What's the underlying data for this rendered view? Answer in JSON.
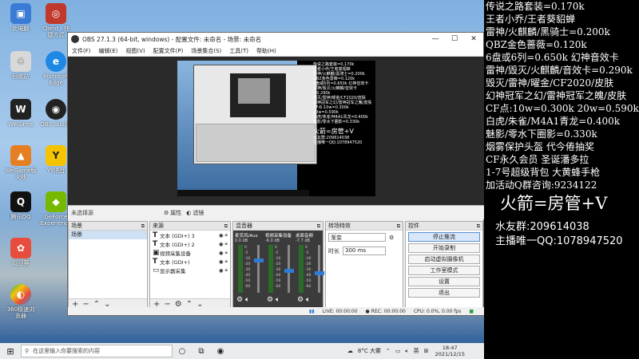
{
  "desktop_icons": [
    {
      "label": "此电脑",
      "color": "#3a7bd5",
      "glyph": "▣"
    },
    {
      "label": "Client - 快\n捷方式",
      "color": "#c0392b",
      "glyph": "◎"
    },
    {
      "label": "回收站",
      "color": "#e6e6e6",
      "glyph": "♲"
    },
    {
      "label": "Microsoft\nEdge",
      "color": "#1e88e5",
      "glyph": "e"
    },
    {
      "label": "WeGame",
      "color": "#222222",
      "glyph": "W"
    },
    {
      "label": "OBS Studio",
      "color": "#222222",
      "glyph": "◉"
    },
    {
      "label": "WeGame版\n火线",
      "color": "#e67e22",
      "glyph": "▲"
    },
    {
      "label": "YY语音",
      "color": "#f5c400",
      "glyph": "Y"
    },
    {
      "label": "腾讯QQ",
      "color": "#111111",
      "glyph": "Q"
    },
    {
      "label": "GeForce\nExperience",
      "color": "#76b900",
      "glyph": "◆"
    },
    {
      "label": "向日葵",
      "color": "#e74c3c",
      "glyph": "✿"
    },
    {
      "label": "360极速浏\n览器",
      "color": "#27ae60",
      "glyph": "◐"
    }
  ],
  "obs": {
    "title": "OBS 27.1.3 (64-bit, windows) - 配置文件: 未命名 - 场景: 未命名",
    "menu": [
      "文件(F)",
      "编辑(E)",
      "视图(V)",
      "配置文件(P)",
      "场景集合(S)",
      "工具(T)",
      "帮助(H)"
    ],
    "current_source": "未选择源",
    "properties_label": "属性",
    "filters_label": "滤镜",
    "scenes": {
      "title": "场景",
      "items": [
        "场景"
      ]
    },
    "sources": {
      "title": "来源",
      "items": [
        {
          "type": "text",
          "label": "文本 (GDI+) 3"
        },
        {
          "type": "text",
          "label": "文本 (GDI+) 2"
        },
        {
          "type": "video",
          "label": "视频采集设备"
        },
        {
          "type": "text",
          "label": "文本 (GDI+)"
        },
        {
          "type": "display",
          "label": "显示器采集"
        }
      ]
    },
    "mixer": {
      "title": "混音器",
      "channels": [
        {
          "name": "麦克风/Aux",
          "db": "0.0 dB",
          "level": 0.72
        },
        {
          "name": "视频采集设备",
          "db": "-6.0 dB",
          "level": 0.5
        },
        {
          "name": "桌面音频",
          "db": "-7.7 dB",
          "level": 0.45
        }
      ],
      "scale": [
        "0",
        "-5",
        "-10",
        "-15",
        "-20",
        "-25",
        "-30",
        "-35",
        "-40",
        "-45",
        "-50",
        "-55",
        "-60"
      ]
    },
    "transitions": {
      "title": "转场特效",
      "type": "渐变",
      "duration_label": "时长",
      "duration": "300 ms"
    },
    "controls": {
      "title": "控件",
      "buttons": [
        "停止推流",
        "开始录制",
        "启动虚拟摄像机",
        "工作室模式",
        "设置",
        "退出"
      ]
    },
    "status": {
      "live": "LIVE: 00:00:00",
      "rec": "REC: 00:00:00",
      "cpu": "CPU: 0.0%, 0.00 fps"
    }
  },
  "taskbar": {
    "search_placeholder": "在这里输入你要搜索的内容",
    "weather": "8°C 大雾",
    "lang": "英",
    "time": "18:47",
    "date": "2021/12/15"
  },
  "overlay": {
    "lines": [
      "传说之路套装=0.170k",
      "王者小乔/王者葵貂蝉",
      "雷神/火麒麟/黑骑士=0.200k",
      "QBZ金色蔷薇=0.120k",
      "6盘或6列=0.650k  幻神音效卡",
      "雷神/毁灭/火麒麟/音效卡=0.290k",
      "毁灭/雷神/曜金/CF2020/皮肤",
      "幻神冠军之幻/雷神冠军之魄/皮肤",
      "CF点:10w=0.300k  20w=0.590k",
      "白虎/朱雀/M4A1青龙=0.400k",
      "魅影/零水下圈影=0.330k",
      "烟雾保护头盔    代今倦抽奖",
      " CF永久会员      圣诞潘多拉",
      "1-7号超级背包    大黄蜂手枪",
      "加活动Q群咨询:9234122"
    ],
    "big": "火箭=房管+V",
    "water_group": "水友群:209614038",
    "anchor_qq": "主播唯一QQ:1078947520"
  }
}
